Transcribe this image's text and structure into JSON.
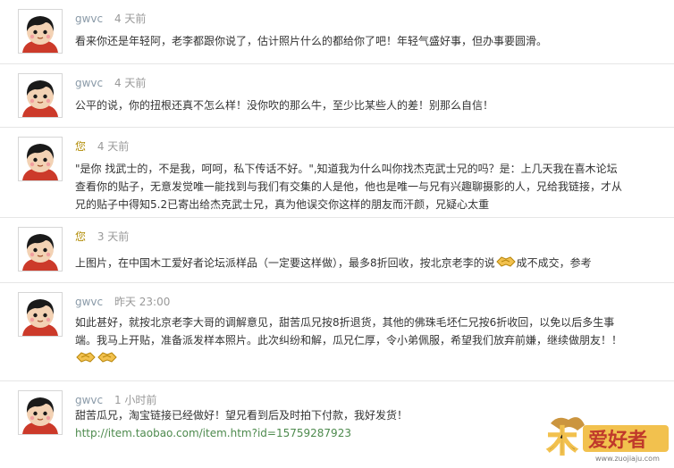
{
  "comments": [
    {
      "author": "gwvc",
      "time": "4 天前",
      "lines": [
        "看来你还是年轻阿，老李都跟你说了，估计照片什么的都给你了吧！年轻气盛好事，但办事要圆滑。"
      ]
    },
    {
      "author": "gwvc",
      "time": "4 天前",
      "lines": [
        "公平的说，你的扭根还真不怎么样！没你吹的那么牛，至少比某些人的差！别那么自信！"
      ]
    },
    {
      "author": "您",
      "time": "4 天前",
      "lines": [
        "\"是你  找武士的，不是我，呵呵，私下传话不好。\",知道我为什么叫你找杰克武士兄的吗？是：上几天我在喜木论坛",
        "查看你的贴子，无意发觉唯一能找到与我们有交集的人是他，他也是唯一与兄有兴趣聊摄影的人，兄给我链接，才从",
        "兄的贴子中得知5.2已寄出给杰克武士兄，真为他误交你这样的朋友而汗颜，兄疑心太重"
      ]
    },
    {
      "author": "您",
      "time": "3 天前",
      "text_before": "上图片，在中国木工爱好者论坛派样品（一定要这样做），最多8折回收，按北京老李的说",
      "text_after": "成不成交，参考",
      "emoji": "handshake-icon"
    },
    {
      "author": "gwvc",
      "time": "昨天 23:00",
      "lines": [
        "如此甚好，就按北京老李大哥的调解意见，甜苦瓜兄按8折退货，其他的佛珠毛坯仁兄按6折收回，以免以后多生事",
        "端。我马上开贴，准备派发样本照片。此次纠纷和解，瓜兄仁厚，令小弟佩服，希望我们放弃前嫌，继续做朋友！！"
      ],
      "emoji": "handshake-icon"
    },
    {
      "author": "gwvc",
      "time": "1 小时前",
      "lines": [
        "甜苦瓜兄，淘宝链接已经做好！望兄看到后及时拍下付款，我好发货！"
      ],
      "link": "http://item.taobao.com/item.htm?id=15759287923"
    }
  ],
  "watermark": {
    "logo_text": "爱好者",
    "logo_char": "木",
    "url": "www.zuojiaju.com"
  },
  "colors": {
    "author_other": "#8a9aa8",
    "author_me": "#b08a00",
    "time": "#999999",
    "link": "#4d8a4d",
    "divider": "#e6e6e6"
  }
}
